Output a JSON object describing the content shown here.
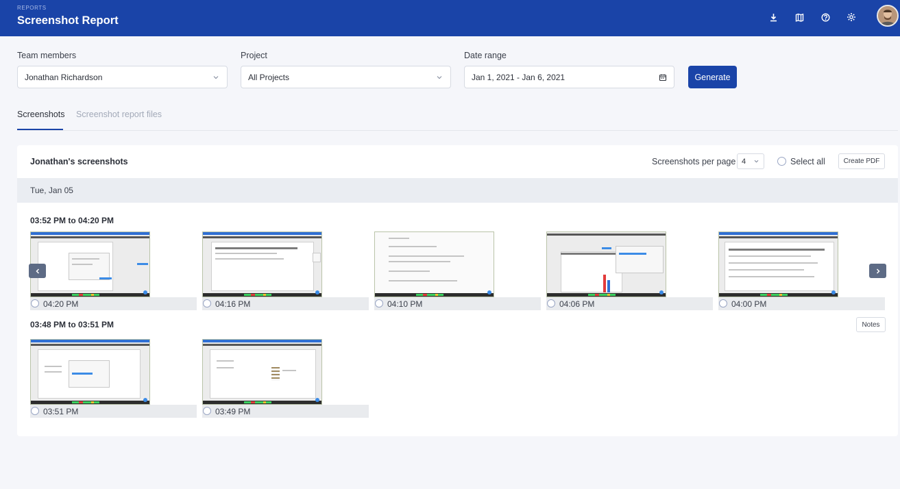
{
  "header": {
    "crumb": "REPORTS",
    "title": "Screenshot Report",
    "icons": [
      "download-icon",
      "map-icon",
      "help-icon",
      "settings-icon"
    ],
    "avatar": "user-avatar"
  },
  "filters": {
    "team_label": "Team members",
    "team_value": "Jonathan Richardson",
    "project_label": "Project",
    "project_value": "All Projects",
    "date_label": "Date range",
    "date_value": "Jan 1, 2021 - Jan 6, 2021",
    "generate_label": "Generate"
  },
  "tabs": [
    {
      "label": "Screenshots",
      "active": true
    },
    {
      "label": "Screenshot report files",
      "active": false
    }
  ],
  "card": {
    "title": "Jonathan's screenshots",
    "per_page_label": "Screenshots per page",
    "per_page_value": "4",
    "select_all_label": "Select all",
    "create_pdf_label": "Create PDF",
    "day": "Tue, Jan 05",
    "notes_label": "Notes",
    "groups": [
      {
        "range": "03:52 PM to 04:20 PM",
        "shots": [
          "04:20 PM",
          "04:16 PM",
          "04:10 PM",
          "04:06 PM",
          "04:00 PM"
        ]
      },
      {
        "range": "03:48 PM to 03:51 PM",
        "shots": [
          "03:51 PM",
          "03:49 PM"
        ]
      }
    ]
  },
  "colors": {
    "brand": "#1a44a8",
    "background": "#f5f6fa",
    "nav_arrow": "#5d6b85"
  }
}
